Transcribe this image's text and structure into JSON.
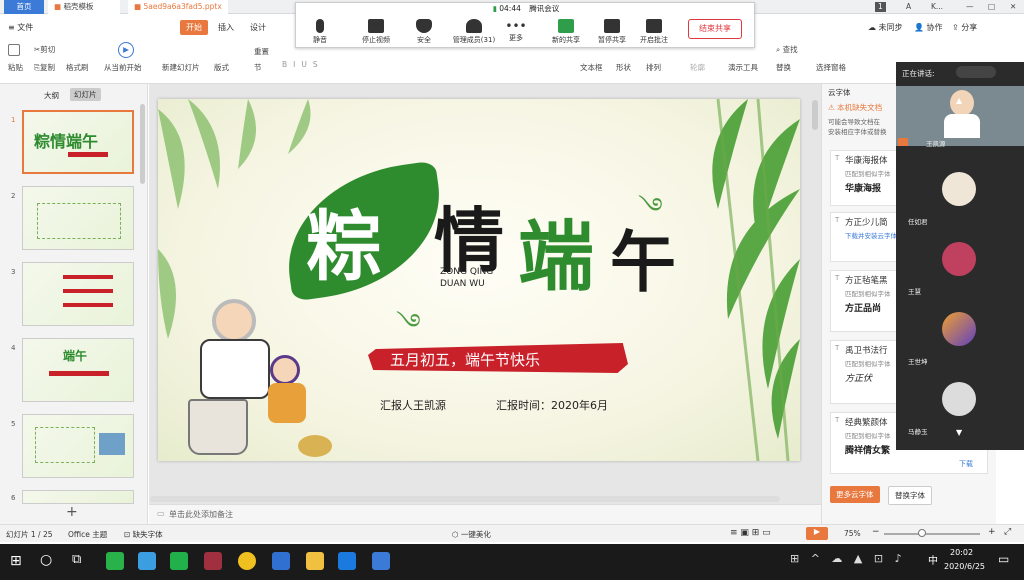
{
  "tabs": {
    "home": "首页",
    "template": "稻壳模板",
    "file": "5aed9a6a3fad5.pptx"
  },
  "titlebar": {
    "badge": "1",
    "user": "A",
    "ell": "K..."
  },
  "menu": {
    "file": "文件",
    "start": "开始",
    "insert": "插入",
    "design": "设计",
    "unsync": "未同步",
    "collab": "协作",
    "share": "分享"
  },
  "ribbon": {
    "paste": "粘贴",
    "cut": "剪切",
    "copy": "复制",
    "format": "格式刷",
    "from_start": "从当前开始",
    "new_slide": "新建幻灯片",
    "layout": "版式",
    "section": "节",
    "reset": "重置",
    "textbox": "文本框",
    "shape": "形状",
    "arrange": "排列",
    "outline": "轮廓",
    "present_tool": "演示工具",
    "replace": "替换",
    "find": "查找",
    "select": "选择窗格"
  },
  "meeting": {
    "time": "04:44",
    "app": "腾讯会议",
    "mute": "静音",
    "video": "停止视频",
    "security": "安全",
    "members": "管理成员(31)",
    "more": "更多",
    "new_share": "新的共享",
    "pause_share": "暂停共享",
    "annotate": "开启批注",
    "end_share": "结束共享"
  },
  "left_panel": {
    "outline": "大纲",
    "slides": "幻灯片",
    "nums": [
      "1",
      "2",
      "3",
      "4",
      "5",
      "6"
    ],
    "thumb_titles": [
      "粽情端午",
      "",
      "",
      "端午",
      "",
      ""
    ]
  },
  "slide": {
    "title_chars": [
      "粽",
      "情",
      "端",
      "午"
    ],
    "pinyin1": "ZONG QING",
    "pinyin2": "DUAN WU",
    "banner": "五月初五，端午节快乐",
    "reporter": "汇报人王凯源",
    "report_time": "汇报时间：2020年6月"
  },
  "right_panel": {
    "title": "云字体",
    "warn": "本机缺失文档",
    "warn_desc1": "可能会导致文档在",
    "warn_desc2": "安装相应字体或替换",
    "fonts": [
      {
        "name": "华康海报体",
        "sub": "匹配到相似字体",
        "sample": "华康海报"
      },
      {
        "name": "方正少儿简",
        "sub": "下载并安装云字体",
        "sample": ""
      },
      {
        "name": "方正毡笔黑",
        "sub": "匹配到相似字体",
        "sample": "方正品尚"
      },
      {
        "name": "禹卫书法行",
        "sub": "匹配到相似字体",
        "sample": "方正伏"
      },
      {
        "name": "经典繁颜体",
        "sub": "匹配到相似字体",
        "sample": "腾祥倩女繁"
      }
    ],
    "download": "下载",
    "more_fonts": "更多云字体",
    "replace_font": "替换字体"
  },
  "video": {
    "speaking": "正在讲话:",
    "names": [
      "王凯源",
      "任如君",
      "王慧",
      "王世坤",
      "马静玉"
    ]
  },
  "notes": "单击此处添加备注",
  "status": {
    "slide": "幻灯片 1 / 25",
    "theme": "Office 主题",
    "missing": "缺失字体",
    "beautify": "一键美化",
    "zoom": "75%"
  },
  "taskbar": {
    "time": "20:02",
    "date": "2020/6/25",
    "lang": "中"
  },
  "colors": {
    "accent": "#e8783e",
    "green": "#2e8b2e",
    "red": "#c8212a",
    "meet_end": "#e0383e"
  }
}
